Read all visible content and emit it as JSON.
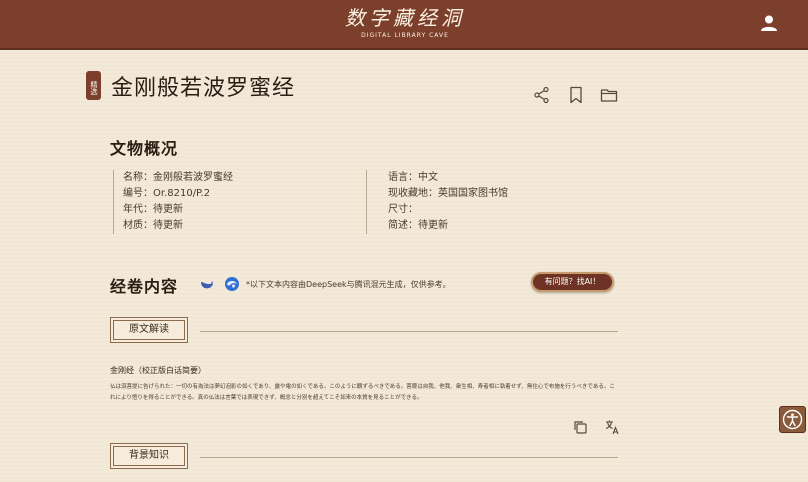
{
  "header": {
    "logo_main": "数字藏经洞",
    "logo_sub": "DIGITAL LIBRARY CAVE",
    "user_icon": "user-icon"
  },
  "title_area": {
    "badge": "精选",
    "title": "金刚般若波罗蜜经",
    "icons": [
      "share-icon",
      "bookmark-icon",
      "folder-icon"
    ]
  },
  "overview": {
    "heading": "文物概况",
    "left": [
      "名称：金刚般若波罗蜜经",
      "编号：Or.8210/P.2",
      "年代：待更新",
      "材质：待更新"
    ],
    "right": [
      "语言：中文",
      "现收藏地：英国国家图书馆",
      "尺寸：",
      "简述：待更新"
    ]
  },
  "content": {
    "heading": "经卷内容",
    "ai_icons": [
      "deepseek-icon",
      "hunyuan-icon"
    ],
    "disclaimer": "*以下文本内容由DeepSeek与腾讯混元生成，仅供参考。",
    "ask_button": "有问题？找AI！",
    "original_tab": "原文解读",
    "source_title": "金刚经（校正版白话简要）",
    "source_body": "仏は須菩提に告げられた：一切の有為法は夢幻泡影の如くであり、露や電の如くである。このように観ずるべきである。菩薩は自我、他我、衆生相、寿者相に執着せず、無住心で布施を行うべきである。これにより悟りを得ることができる。真の仏法は言葉では表現できず、概念と分別を超えてこそ如来の本質を見ることができる。",
    "action_icons": [
      "copy-icon",
      "translate-icon"
    ],
    "background_tab": "背景知识"
  },
  "accessibility_icon": "accessibility-icon"
}
